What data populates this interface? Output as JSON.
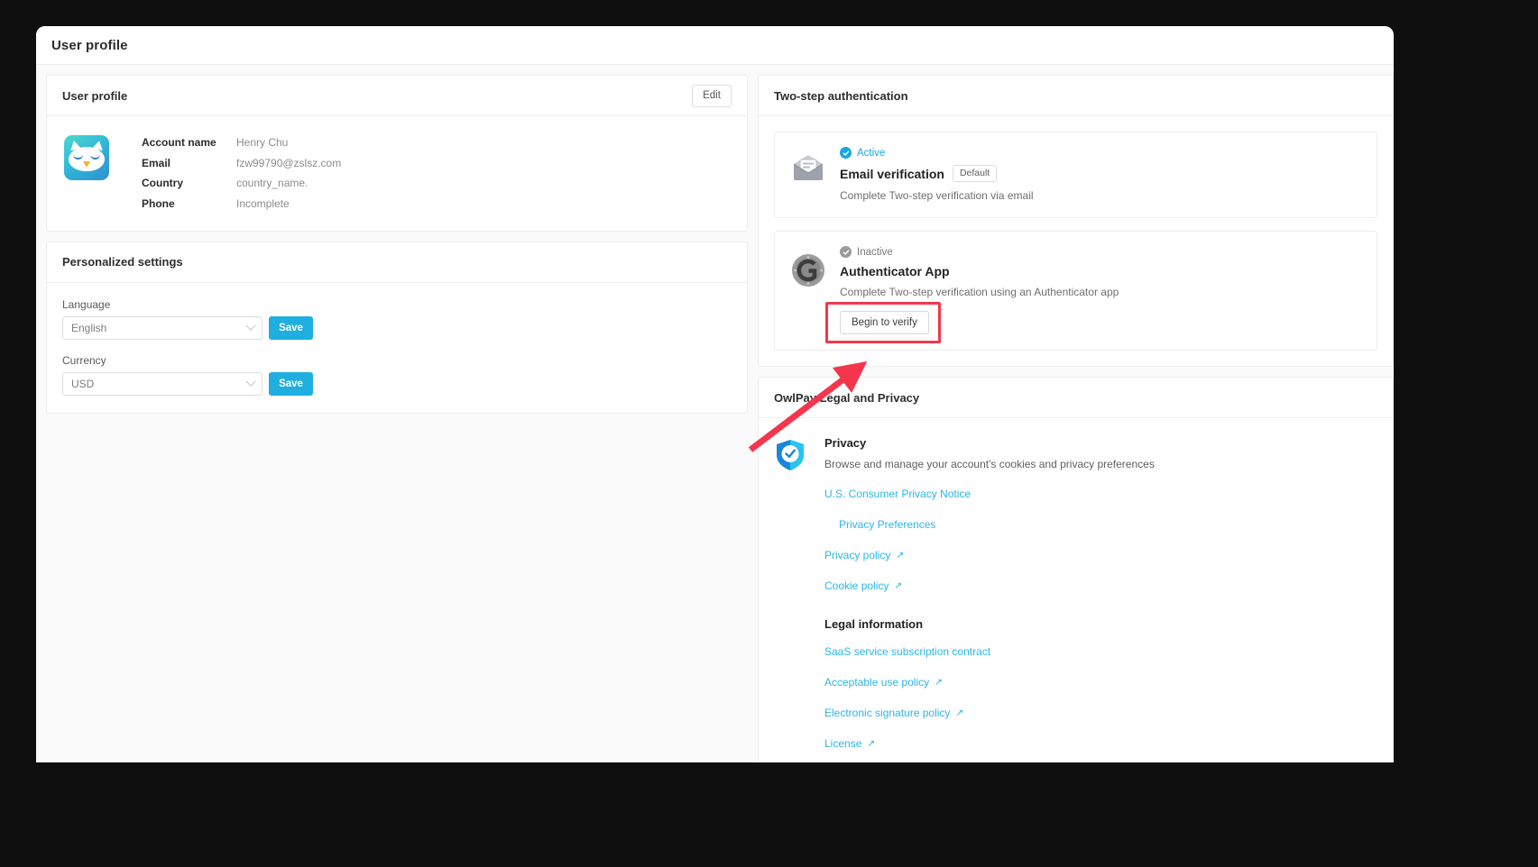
{
  "page": {
    "title": "User profile"
  },
  "profile_card": {
    "title": "User profile",
    "edit_label": "Edit",
    "avatar_icon": "owl-avatar",
    "fields": [
      {
        "label": "Account name",
        "value": "Henry Chu"
      },
      {
        "label": "Email",
        "value": "fzw99790@zslsz.com"
      },
      {
        "label": "Country",
        "value": "country_name."
      },
      {
        "label": "Phone",
        "value": "Incomplete"
      }
    ]
  },
  "personalized": {
    "title": "Personalized settings",
    "language": {
      "label": "Language",
      "value": "English",
      "save_label": "Save"
    },
    "currency": {
      "label": "Currency",
      "value": "USD",
      "save_label": "Save"
    }
  },
  "two_step": {
    "title": "Two-step authentication",
    "methods": [
      {
        "icon": "envelope-icon",
        "status": "Active",
        "status_state": "active",
        "name": "Email verification",
        "badge": "Default",
        "description": "Complete Two-step verification via email"
      },
      {
        "icon": "authenticator-icon",
        "status": "Inactive",
        "status_state": "inactive",
        "name": "Authenticator App",
        "badge": "",
        "description": "Complete Two-step verification using an Authenticator app",
        "action_label": "Begin to verify"
      }
    ]
  },
  "legal": {
    "title": "OwlPay Legal and Privacy",
    "privacy": {
      "icon": "shield-check-icon",
      "heading": "Privacy",
      "description": "Browse and manage your account's cookies and privacy preferences",
      "links": [
        {
          "label": "U.S. Consumer Privacy Notice",
          "external": false,
          "indent": false
        },
        {
          "label": "Privacy Preferences",
          "external": false,
          "indent": true
        },
        {
          "label": "Privacy policy",
          "external": true,
          "indent": false
        },
        {
          "label": "Cookie policy",
          "external": true,
          "indent": false
        }
      ]
    },
    "legal_info": {
      "heading": "Legal information",
      "links": [
        {
          "label": "SaaS service subscription contract",
          "external": false
        },
        {
          "label": "Acceptable use policy",
          "external": true
        },
        {
          "label": "Electronic signature policy",
          "external": true
        },
        {
          "label": "License",
          "external": true
        }
      ]
    }
  },
  "annotation": {
    "highlight_color": "#f4364c",
    "arrow_target": "Begin to verify"
  },
  "colors": {
    "accent": "#1eaee0",
    "link": "#2bb6e4",
    "active_status": "#16a7dd",
    "inactive_status": "#9a9a9a"
  },
  "icons": {
    "external_link": "↗"
  }
}
